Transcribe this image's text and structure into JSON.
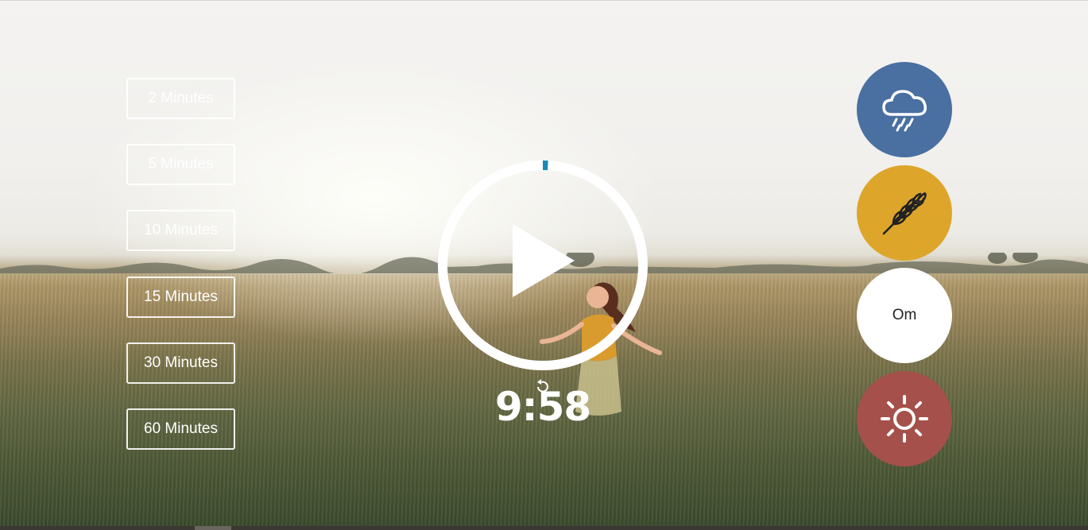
{
  "durations": [
    {
      "label": "2 Minutes"
    },
    {
      "label": "5 Minutes"
    },
    {
      "label": "10 Minutes"
    },
    {
      "label": "15 Minutes"
    },
    {
      "label": "30 Minutes"
    },
    {
      "label": "60 Minutes"
    }
  ],
  "timer": {
    "display": "9:58",
    "progress": 0.003
  },
  "sounds": {
    "rain": {
      "icon": "rain-cloud-icon",
      "color": "#4a6fa1"
    },
    "wheat": {
      "icon": "wheat-icon",
      "color": "#dda62a"
    },
    "om": {
      "label": "Om",
      "color": "#ffffff"
    },
    "sun": {
      "icon": "sun-icon",
      "color": "#a5504a"
    }
  },
  "icons": {
    "play": "play-icon",
    "reset": "reset-icon"
  }
}
